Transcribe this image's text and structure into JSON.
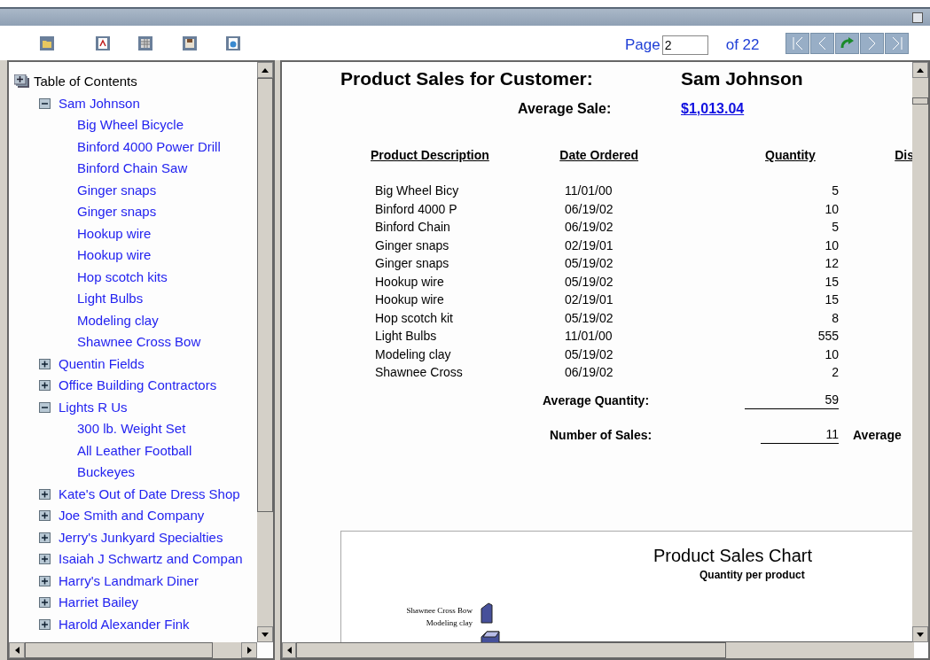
{
  "toolbar": {
    "page_label": "Page",
    "page_value": "2",
    "page_total": "of 22"
  },
  "toc": {
    "title": "Table of Contents",
    "items": [
      {
        "label": "Sam Johnson",
        "expanded": true,
        "children": [
          {
            "label": "Big Wheel Bicycle"
          },
          {
            "label": "Binford 4000 Power Drill"
          },
          {
            "label": "Binford Chain Saw"
          },
          {
            "label": "Ginger snaps"
          },
          {
            "label": "Ginger snaps"
          },
          {
            "label": "Hookup wire"
          },
          {
            "label": "Hookup wire"
          },
          {
            "label": "Hop scotch kits"
          },
          {
            "label": "Light Bulbs"
          },
          {
            "label": "Modeling clay"
          },
          {
            "label": "Shawnee Cross Bow"
          }
        ]
      },
      {
        "label": "Quentin Fields",
        "expanded": false
      },
      {
        "label": "Office Building Contractors",
        "expanded": false
      },
      {
        "label": "Lights R Us",
        "expanded": true,
        "children": [
          {
            "label": "300 lb. Weight Set"
          },
          {
            "label": "All Leather Football"
          },
          {
            "label": "Buckeyes"
          }
        ]
      },
      {
        "label": "Kate's Out of Date Dress Shop",
        "expanded": false
      },
      {
        "label": "Joe Smith and Company",
        "expanded": false
      },
      {
        "label": "Jerry's Junkyard Specialties",
        "expanded": false
      },
      {
        "label": "Isaiah J Schwartz and Compan",
        "expanded": false
      },
      {
        "label": "Harry's Landmark Diner",
        "expanded": false
      },
      {
        "label": "Harriet Bailey",
        "expanded": false
      },
      {
        "label": "Harold Alexander Fink",
        "expanded": false
      }
    ]
  },
  "report": {
    "title": "Product Sales for Customer:",
    "customer": "Sam Johnson",
    "average_sale_label": "Average Sale:",
    "average_sale_value": "$1,013.04",
    "columns": [
      "Product Description",
      "Date Ordered",
      "Quantity",
      "Dis"
    ],
    "rows": [
      [
        "Big Wheel Bicy",
        "11/01/00",
        "5"
      ],
      [
        "Binford 4000 P",
        "06/19/02",
        "10"
      ],
      [
        "Binford Chain",
        "06/19/02",
        "5"
      ],
      [
        "Ginger snaps",
        "02/19/01",
        "10"
      ],
      [
        "Ginger snaps",
        "05/19/02",
        "12"
      ],
      [
        "Hookup wire",
        "05/19/02",
        "15"
      ],
      [
        "Hookup wire",
        "02/19/01",
        "15"
      ],
      [
        "Hop scotch kit",
        "05/19/02",
        "8"
      ],
      [
        "Light Bulbs",
        "11/01/00",
        "555"
      ],
      [
        "Modeling clay",
        "05/19/02",
        "10"
      ],
      [
        "Shawnee Cross",
        "06/19/02",
        "2"
      ]
    ],
    "average_quantity_label": "Average Quantity:",
    "average_quantity_value": "59",
    "number_of_sales_label": "Number of Sales:",
    "number_of_sales_value": "11",
    "cut_label": "Average",
    "chart": {
      "title": "Product Sales Chart",
      "subtitle": "Quantity per product",
      "category_labels": [
        "Shawnee Cross Bow",
        "Modeling clay"
      ]
    }
  }
}
